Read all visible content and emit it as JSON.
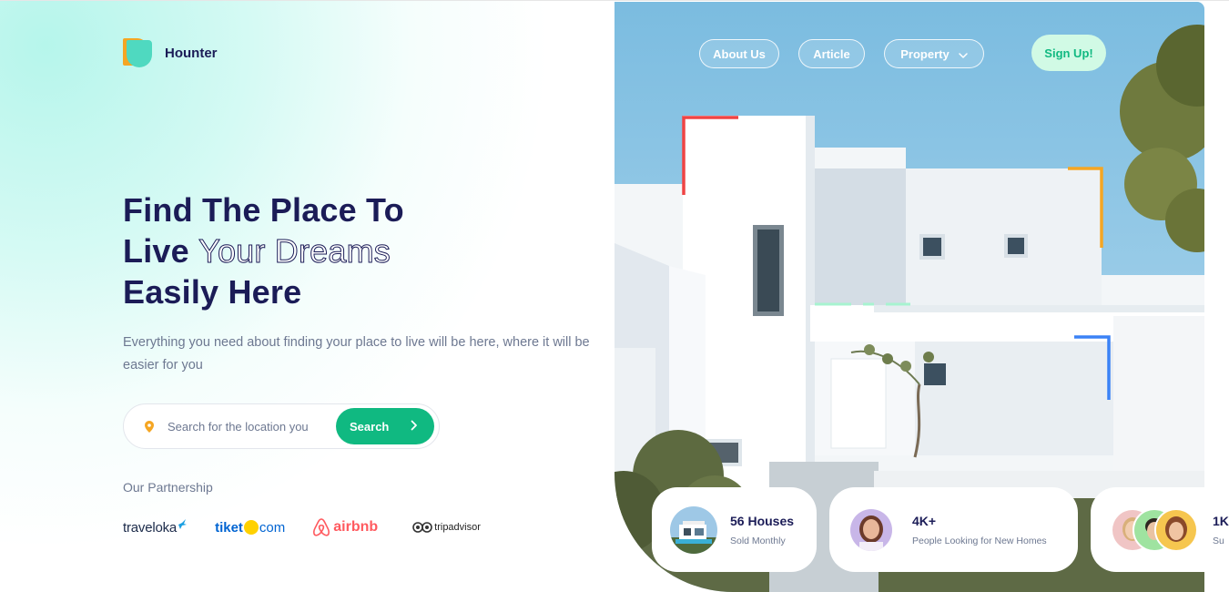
{
  "brand": {
    "name": "Hounter"
  },
  "nav": {
    "items": [
      {
        "label": "About Us"
      },
      {
        "label": "Article"
      },
      {
        "label": "Property"
      }
    ],
    "signup_label": "Sign Up!"
  },
  "hero": {
    "title_line1": "Find The Place To",
    "title_line2_solid": "Live",
    "title_line2_outline": "Your Dreams",
    "title_line3": "Easily Here",
    "subtitle": "Everything you need about finding your place to live will be here, where it will be easier for you"
  },
  "search": {
    "placeholder": "Search for the location you",
    "button_label": "Search"
  },
  "partnership": {
    "label": "Our Partnership",
    "partners": [
      {
        "name": "traveloka"
      },
      {
        "name_part1": "tiket",
        "name_part2": "com"
      },
      {
        "name": "airbnb"
      },
      {
        "name": "tripadvisor"
      }
    ]
  },
  "stats": [
    {
      "value": "56 Houses",
      "label": "Sold Monthly"
    },
    {
      "value": "4K+",
      "label": "People Looking for New Homes"
    },
    {
      "value": "1K",
      "label": "Su"
    }
  ],
  "colors": {
    "navy": "#1b1c57",
    "accent_green": "#10b981",
    "signup_bg": "#d1fae5",
    "muted_text": "#6d7891"
  }
}
